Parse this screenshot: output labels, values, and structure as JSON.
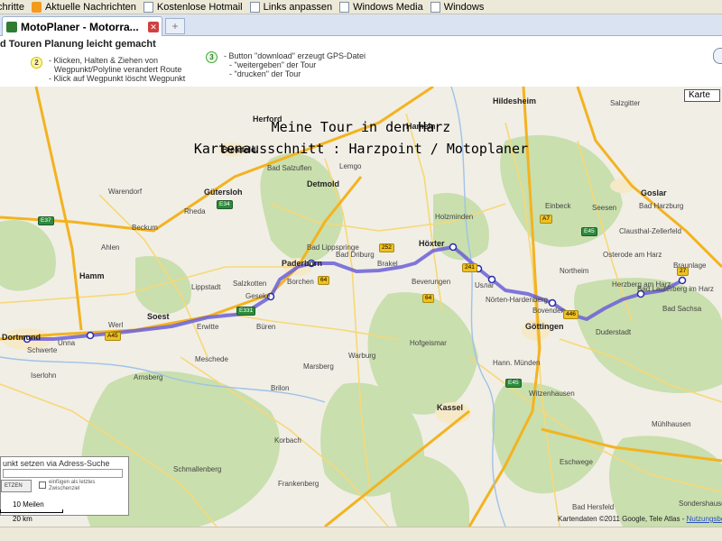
{
  "bookmarks": [
    {
      "label": "chritte",
      "icon": "page-icon"
    },
    {
      "label": "Aktuelle Nachrichten",
      "icon": "rss-feed-icon"
    },
    {
      "label": "Kostenlose Hotmail",
      "icon": "page-icon"
    },
    {
      "label": "Links anpassen",
      "icon": "page-icon"
    },
    {
      "label": "Windows Media",
      "icon": "page-icon"
    },
    {
      "label": "Windows",
      "icon": "page-icon"
    }
  ],
  "tab": {
    "title": "MotoPlaner - Motorra...",
    "close": "✕",
    "new_tab": "+"
  },
  "instructions": {
    "title": "d Touren Planung leicht gemacht",
    "step2_num": "2",
    "step2_lines": [
      "- Klicken, Halten & Ziehen von",
      "Wegpunkt/Polyline verandert Route",
      "- Klick auf Wegpunkt löscht Wegpunkt"
    ],
    "step3_num": "3",
    "step3_lines": [
      "- Button \"download\" erzeugt GPS-Datei",
      "- \"weitergeben\" der Tour",
      "- \"drucken\" der Tour"
    ]
  },
  "map": {
    "type_button": "Karte",
    "overlay_line1": "Meine Tour in den Harz",
    "overlay_line2": "Kartenausschnitt : Harzpoint / Motoplaner",
    "places": [
      {
        "name": "Hildesheim",
        "big": true
      },
      {
        "name": "Salzgitter",
        "big": false
      },
      {
        "name": "Herford",
        "big": true
      },
      {
        "name": "Bielefeld",
        "big": true
      },
      {
        "name": "Detmold",
        "big": true
      },
      {
        "name": "Gütersloh",
        "big": true
      },
      {
        "name": "Hameln",
        "big": true
      },
      {
        "name": "Lemgo",
        "big": false
      },
      {
        "name": "Hamm",
        "big": true
      },
      {
        "name": "Paderborn",
        "big": true
      },
      {
        "name": "Höxter",
        "big": true
      },
      {
        "name": "Lippstadt",
        "big": false
      },
      {
        "name": "Soest",
        "big": true
      },
      {
        "name": "Unna",
        "big": false
      },
      {
        "name": "Dortmund",
        "big": true
      },
      {
        "name": "Northeim",
        "big": false
      },
      {
        "name": "Göttingen",
        "big": true
      },
      {
        "name": "Goslar",
        "big": true
      },
      {
        "name": "Bad Harzburg",
        "big": false
      },
      {
        "name": "Bad Lauterberg im Harz",
        "big": false
      },
      {
        "name": "Kassel",
        "big": true
      },
      {
        "name": "Iserlohn",
        "big": false
      },
      {
        "name": "Arnsberg",
        "big": false
      },
      {
        "name": "Brilon",
        "big": false
      },
      {
        "name": "Warburg",
        "big": false
      },
      {
        "name": "Bad Driburg",
        "big": false
      },
      {
        "name": "Brakel",
        "big": false
      },
      {
        "name": "Eschwege",
        "big": false
      },
      {
        "name": "Osterode am Harz",
        "big": false
      },
      {
        "name": "Herzberg am Harz",
        "big": false
      },
      {
        "name": "Duderstadt",
        "big": false
      },
      {
        "name": "Einbeck",
        "big": false
      },
      {
        "name": "Holzminden",
        "big": false
      },
      {
        "name": "Bad Salzuflen",
        "big": false
      },
      {
        "name": "Bad Lippspringe",
        "big": false
      },
      {
        "name": "Hann. Münden",
        "big": false
      },
      {
        "name": "Mühlhausen",
        "big": false
      },
      {
        "name": "Bad Hersfeld",
        "big": false
      },
      {
        "name": "Bovenden",
        "big": false
      },
      {
        "name": "Nörten-Hardenberg",
        "big": false
      },
      {
        "name": "Usлar",
        "big": false
      },
      {
        "name": "Schwerte",
        "big": false
      },
      {
        "name": "Meschede",
        "big": false
      },
      {
        "name": "Marsberg",
        "big": false
      },
      {
        "name": "Korbach",
        "big": false
      },
      {
        "name": "Frankenberg",
        "big": false
      },
      {
        "name": "Schmallenberg",
        "big": false
      },
      {
        "name": "Ahlen",
        "big": false
      },
      {
        "name": "Beckum",
        "big": false
      },
      {
        "name": "Warendorf",
        "big": false
      },
      {
        "name": "Rheda",
        "big": false
      },
      {
        "name": "Werl",
        "big": false
      },
      {
        "name": "Erwitte",
        "big": false
      },
      {
        "name": "Geseke",
        "big": false
      },
      {
        "name": "Salzkotten",
        "big": false
      },
      {
        "name": "Büren",
        "big": false
      },
      {
        "name": "Borchen",
        "big": false
      },
      {
        "name": "Beverungen",
        "big": false
      },
      {
        "name": "Bad Sachsa",
        "big": false
      },
      {
        "name": "Braunlage",
        "big": false
      },
      {
        "name": "Clausthal-Zellerfeld",
        "big": false
      },
      {
        "name": "Seesen",
        "big": false
      },
      {
        "name": "Northeim",
        "big": false
      },
      {
        "name": "Hofgeismar",
        "big": false
      },
      {
        "name": "Witzenhausen",
        "big": false
      },
      {
        "name": "Sondershausen",
        "big": false
      }
    ],
    "attribution": "Kartendaten ©2011 Google, Tele Atlas - ",
    "attribution_link": "Nutzungsbed"
  },
  "search": {
    "title": "unkt setzen via Adress-Suche",
    "button": "ETZEN",
    "checkbox_label": "einfügen als letztes Zwischenziel"
  },
  "scale": {
    "line1": "10 Meilen",
    "line2": "20 km"
  },
  "colors": {
    "route": "#6b5fd6",
    "autobahn": "#f3b320",
    "forest": "#c9dfae",
    "urban": "#f3ead4"
  }
}
